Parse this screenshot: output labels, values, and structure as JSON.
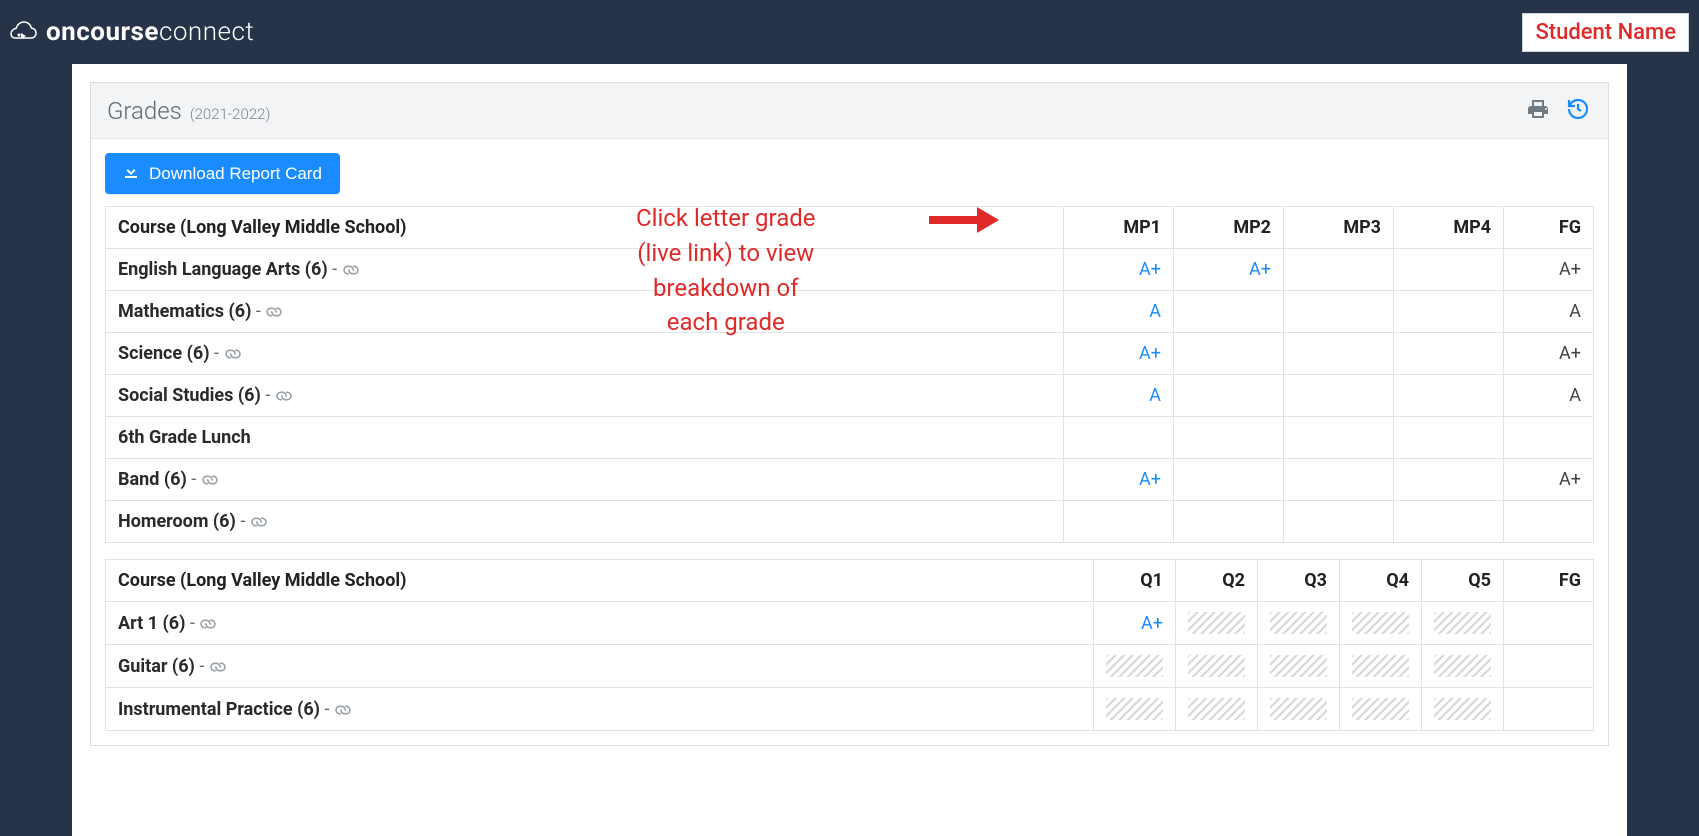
{
  "brand": {
    "word1": "oncourse",
    "word2": "connect"
  },
  "student_badge": "Student Name",
  "panel": {
    "title": "Grades",
    "year": "(2021-2022)"
  },
  "buttons": {
    "download": "Download Report Card"
  },
  "annotation": {
    "line1": "Click letter grade",
    "line2": "(live link) to view",
    "line3": "breakdown of",
    "line4": "each grade"
  },
  "table1": {
    "header": "Course (Long Valley Middle School)",
    "terms": [
      "MP1",
      "MP2",
      "MP3",
      "MP4",
      "FG"
    ],
    "rows": [
      {
        "name": "English Language Arts (6)",
        "link": true,
        "grades": [
          "A+",
          "A+",
          "",
          "",
          "A+"
        ],
        "live": [
          true,
          true,
          false,
          false,
          false
        ]
      },
      {
        "name": "Mathematics (6)",
        "link": true,
        "grades": [
          "A",
          "",
          "",
          "",
          "A"
        ],
        "live": [
          true,
          false,
          false,
          false,
          false
        ]
      },
      {
        "name": "Science (6)",
        "link": true,
        "grades": [
          "A+",
          "",
          "",
          "",
          "A+"
        ],
        "live": [
          true,
          false,
          false,
          false,
          false
        ]
      },
      {
        "name": "Social Studies (6)",
        "link": true,
        "grades": [
          "A",
          "",
          "",
          "",
          "A"
        ],
        "live": [
          true,
          false,
          false,
          false,
          false
        ]
      },
      {
        "name": "6th Grade Lunch",
        "link": false,
        "grades": [
          "",
          "",
          "",
          "",
          ""
        ],
        "live": [
          false,
          false,
          false,
          false,
          false
        ]
      },
      {
        "name": "Band (6)",
        "link": true,
        "grades": [
          "A+",
          "",
          "",
          "",
          "A+"
        ],
        "live": [
          true,
          false,
          false,
          false,
          false
        ]
      },
      {
        "name": "Homeroom (6)",
        "link": true,
        "grades": [
          "",
          "",
          "",
          "",
          ""
        ],
        "live": [
          false,
          false,
          false,
          false,
          false
        ]
      }
    ]
  },
  "table2": {
    "header": "Course (Long Valley Middle School)",
    "terms": [
      "Q1",
      "Q2",
      "Q3",
      "Q4",
      "Q5",
      "FG"
    ],
    "rows": [
      {
        "name": "Art 1 (6)",
        "link": true,
        "cells": [
          {
            "type": "grade",
            "value": "A+",
            "live": true
          },
          {
            "type": "hatched"
          },
          {
            "type": "hatched"
          },
          {
            "type": "hatched"
          },
          {
            "type": "hatched"
          },
          {
            "type": "blank"
          }
        ]
      },
      {
        "name": "Guitar (6)",
        "link": true,
        "cells": [
          {
            "type": "hatched"
          },
          {
            "type": "hatched"
          },
          {
            "type": "hatched"
          },
          {
            "type": "hatched"
          },
          {
            "type": "hatched"
          },
          {
            "type": "blank"
          }
        ]
      },
      {
        "name": "Instrumental Practice (6)",
        "link": true,
        "cells": [
          {
            "type": "hatched"
          },
          {
            "type": "hatched"
          },
          {
            "type": "hatched"
          },
          {
            "type": "hatched"
          },
          {
            "type": "hatched"
          },
          {
            "type": "blank"
          }
        ]
      }
    ]
  }
}
